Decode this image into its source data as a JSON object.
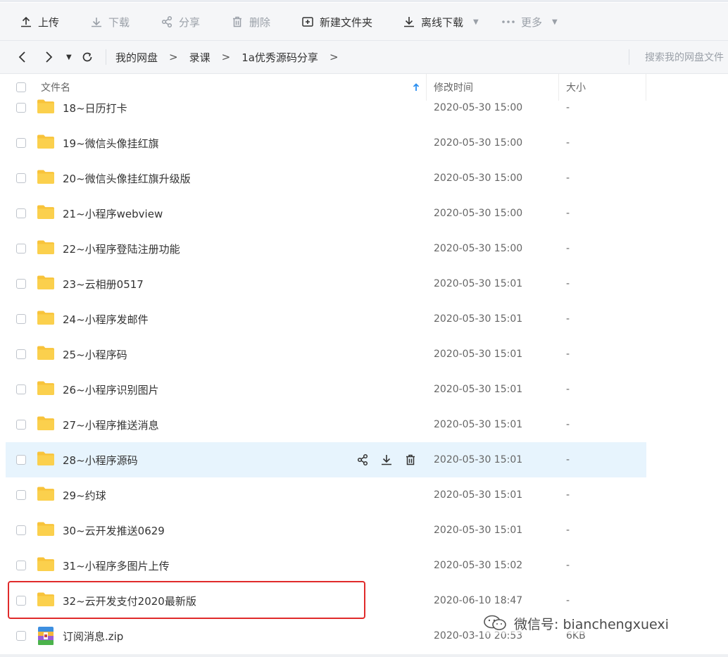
{
  "toolbar": {
    "upload": "上传",
    "download": "下载",
    "share": "分享",
    "delete": "删除",
    "new_folder": "新建文件夹",
    "offline_download": "离线下载",
    "more": "更多"
  },
  "breadcrumb": {
    "items": [
      "我的网盘",
      "录课",
      "1a优秀源码分享"
    ],
    "separator": ">"
  },
  "search": {
    "placeholder": "搜索我的网盘文件"
  },
  "table": {
    "headers": {
      "name": "文件名",
      "modified": "修改时间",
      "size": "大小"
    },
    "rows": [
      {
        "name": "18~日历打卡",
        "time": "2020-05-30 15:00",
        "size": "-",
        "type": "folder"
      },
      {
        "name": "19~微信头像挂红旗",
        "time": "2020-05-30 15:00",
        "size": "-",
        "type": "folder"
      },
      {
        "name": "20~微信头像挂红旗升级版",
        "time": "2020-05-30 15:00",
        "size": "-",
        "type": "folder"
      },
      {
        "name": "21~小程序webview",
        "time": "2020-05-30 15:00",
        "size": "-",
        "type": "folder"
      },
      {
        "name": "22~小程序登陆注册功能",
        "time": "2020-05-30 15:00",
        "size": "-",
        "type": "folder"
      },
      {
        "name": "23~云相册0517",
        "time": "2020-05-30 15:01",
        "size": "-",
        "type": "folder"
      },
      {
        "name": "24~小程序发邮件",
        "time": "2020-05-30 15:01",
        "size": "-",
        "type": "folder"
      },
      {
        "name": "25~小程序码",
        "time": "2020-05-30 15:01",
        "size": "-",
        "type": "folder"
      },
      {
        "name": "26~小程序识别图片",
        "time": "2020-05-30 15:01",
        "size": "-",
        "type": "folder"
      },
      {
        "name": "27~小程序推送消息",
        "time": "2020-05-30 15:01",
        "size": "-",
        "type": "folder"
      },
      {
        "name": "28~小程序源码",
        "time": "2020-05-30 15:01",
        "size": "-",
        "type": "folder",
        "hovered": true
      },
      {
        "name": "29~约球",
        "time": "2020-05-30 15:01",
        "size": "-",
        "type": "folder"
      },
      {
        "name": "30~云开发推送0629",
        "time": "2020-05-30 15:01",
        "size": "-",
        "type": "folder"
      },
      {
        "name": "31~小程序多图片上传",
        "time": "2020-05-30 15:02",
        "size": "-",
        "type": "folder"
      },
      {
        "name": "32~云开发支付2020最新版",
        "time": "2020-06-10 18:47",
        "size": "-",
        "type": "folder",
        "highlighted": true
      },
      {
        "name": "订阅消息.zip",
        "time": "2020-03-10 20:53",
        "size": "6KB",
        "type": "zip"
      }
    ]
  },
  "watermark": {
    "text": "微信号: bianchengxuexi"
  },
  "colors": {
    "toolbar_bg": "#f5f6f8",
    "folder": "#f8c33a",
    "hover_row": "#e7f4fd",
    "highlight_border": "#e02b2b",
    "sort_arrow": "#2a8ef0"
  }
}
